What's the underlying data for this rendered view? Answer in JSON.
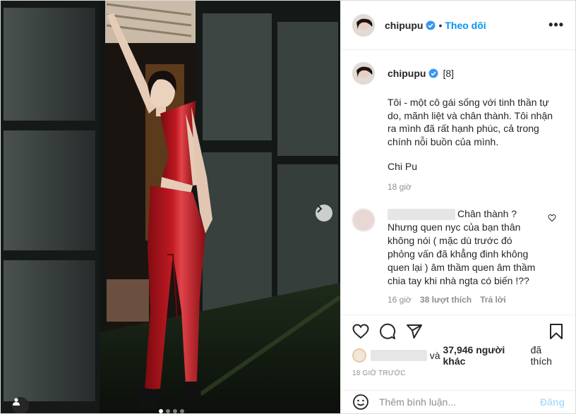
{
  "header": {
    "username": "chipupu",
    "separator": "•",
    "follow_label": "Theo dõi",
    "more_label": "•••"
  },
  "caption": {
    "username": "chipupu",
    "tag": "[8]",
    "text": "Tôi - một cô gái sống với tinh thần tự do, mãnh liệt và chân thành. Tôi nhận ra mình đã rất hạnh phúc, cả trong chính nỗi buồn của mình.",
    "signature": "Chi Pu",
    "time": "18 giờ"
  },
  "comment": {
    "text": "Chân thành ? Nhưng quen nyc của bạn thân không nói ( mặc dù trước đó phỏng vấn đã khẳng đinh không quen lại ) âm thầm quen âm thầm chia tay khi nhà ngta có biến !??",
    "time": "16 giờ",
    "likes": "38 lượt thích",
    "reply_label": "Trả lời"
  },
  "likes": {
    "connector": "và",
    "count": "37,946 người khác",
    "suffix": "đã thích"
  },
  "post_age": "18 GIỜ TRƯỚC",
  "add_comment": {
    "placeholder": "Thêm bình luận...",
    "post_label": "Đăng"
  },
  "colors": {
    "accent": "#0095f6",
    "verified": "#3897f0",
    "post_disabled": "#b2dffc",
    "dress": "#b3141b"
  },
  "carousel": {
    "slides": 4,
    "active": 1
  }
}
